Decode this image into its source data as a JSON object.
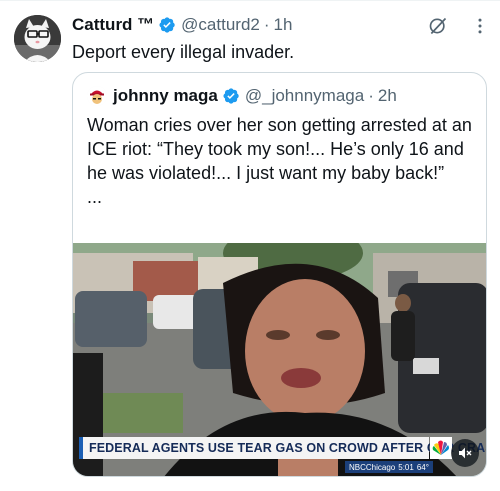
{
  "author": {
    "name": "Catturd ™",
    "handle": "@catturd2",
    "separator": "·",
    "time": "1h",
    "verified": true,
    "avatar_icon": "cat-avatar-icon"
  },
  "tweet_text": "Deport every illegal invader.",
  "header_icons": [
    "grok-icon",
    "more-icon"
  ],
  "quoted": {
    "name": "johnny maga",
    "handle": "@_johnnymaga",
    "separator": "·",
    "time": "2h",
    "verified": true,
    "avatar_icon": "emoji-avatar-icon",
    "text": "Woman cries over her son getting arrested at an ICE riot: “They took my son!... He’s only 16 and he was violated!... I just want my baby back!”\n...",
    "media": {
      "type": "video",
      "banner": "FEDERAL AGENTS USE TEAR GAS ON CROWD AFTER CAR CRASH",
      "source": "NBCChicago",
      "clock": "5:01",
      "temperature": "64°",
      "mute_icon": "speaker-muted-icon"
    }
  },
  "colors": {
    "verified_blue": "#1d9bf0",
    "text_primary": "#0f1419",
    "text_secondary": "#536471",
    "border": "#cfd9de",
    "banner_blue": "#1b5fb4"
  }
}
